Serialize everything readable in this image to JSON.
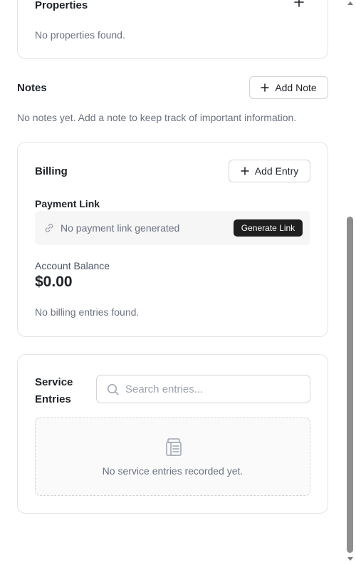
{
  "properties": {
    "title": "Properties",
    "empty_text": "No properties found."
  },
  "notes": {
    "title": "Notes",
    "add_label": "Add Note",
    "empty_text": "No notes yet. Add a note to keep track of important information."
  },
  "billing": {
    "title": "Billing",
    "add_label": "Add Entry",
    "payment_link_label": "Payment Link",
    "payment_link_status": "No payment link generated",
    "generate_label": "Generate Link",
    "balance_label": "Account Balance",
    "balance_value": "$0.00",
    "empty_text": "No billing entries found."
  },
  "service": {
    "title": "Service Entries",
    "search_placeholder": "Search entries...",
    "search_value": "",
    "empty_text": "No service entries recorded yet."
  },
  "icons": {
    "plus": "plus-icon",
    "link": "link-icon",
    "search": "search-icon",
    "clipboard": "clipboard-list-icon"
  },
  "colors": {
    "primary_button": "#1f1f1f",
    "border": "#e4e4e7",
    "muted_text": "#6b7280"
  }
}
